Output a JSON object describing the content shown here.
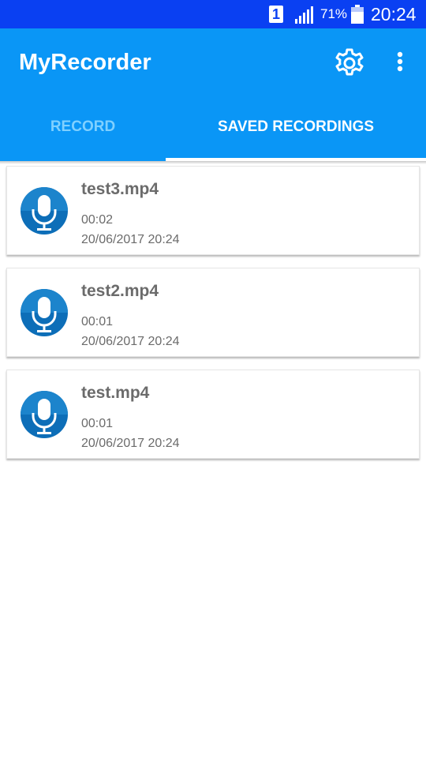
{
  "status_bar": {
    "sim": "1",
    "battery_percent": "71%",
    "time": "20:24"
  },
  "app_bar": {
    "title": "MyRecorder",
    "icons": [
      "settings-gear-icon",
      "more-vert-icon"
    ]
  },
  "tabs": [
    {
      "label": "RECORD",
      "active": false
    },
    {
      "label": "SAVED RECORDINGS",
      "active": true
    }
  ],
  "recordings": [
    {
      "name": "test3.mp4",
      "duration": "00:02",
      "date": "20/06/2017 20:24"
    },
    {
      "name": "test2.mp4",
      "duration": "00:01",
      "date": "20/06/2017 20:24"
    },
    {
      "name": "test.mp4",
      "duration": "00:01",
      "date": "20/06/2017 20:24"
    }
  ],
  "colors": {
    "status_bar": "#0a40f2",
    "primary": "#0a96f6",
    "inactive_tab": "#7fd0ff",
    "card_text": "#6b6b6b"
  }
}
